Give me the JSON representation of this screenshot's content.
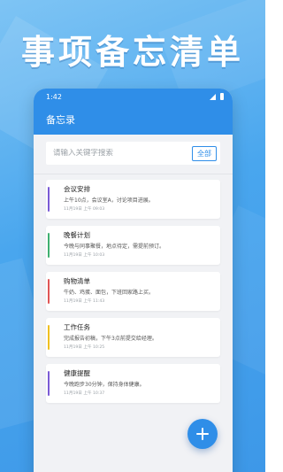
{
  "promo": {
    "headline": "事项备忘清单"
  },
  "status_bar": {
    "time": "1:42"
  },
  "app_bar": {
    "title": "备忘录"
  },
  "search": {
    "placeholder": "请输入关键字搜索",
    "filter_label": "全部"
  },
  "notes": [
    {
      "title": "会议安排",
      "content": "上午10点，会议室A，讨论项目进展。",
      "time": "11月19日 上午 09:03",
      "color": "#7a5bd6"
    },
    {
      "title": "晚餐计划",
      "content": "今晚与同事聚餐，地点待定，需提前预订。",
      "time": "11月19日 上午 10:03",
      "color": "#3fb070"
    },
    {
      "title": "购物清单",
      "content": "牛奶、鸡蛋、面包，下班回家路上买。",
      "time": "11月19日 上午 11:43",
      "color": "#e05555"
    },
    {
      "title": "工作任务",
      "content": "完成报告初稿，下午3点前提交给经理。",
      "time": "11月19日 上午 10:25",
      "color": "#f0c020"
    },
    {
      "title": "健康提醒",
      "content": "今晚跑步30分钟，保持身体健康。",
      "time": "11月19日 上午 10:37",
      "color": "#7a5bd6"
    }
  ],
  "icons": {
    "signal": "signal-icon",
    "battery": "battery-icon",
    "add": "plus-icon"
  },
  "colors": {
    "accent": "#2f8ee8",
    "background_top": "#7ec4f4",
    "background_bottom": "#3d98e8"
  }
}
